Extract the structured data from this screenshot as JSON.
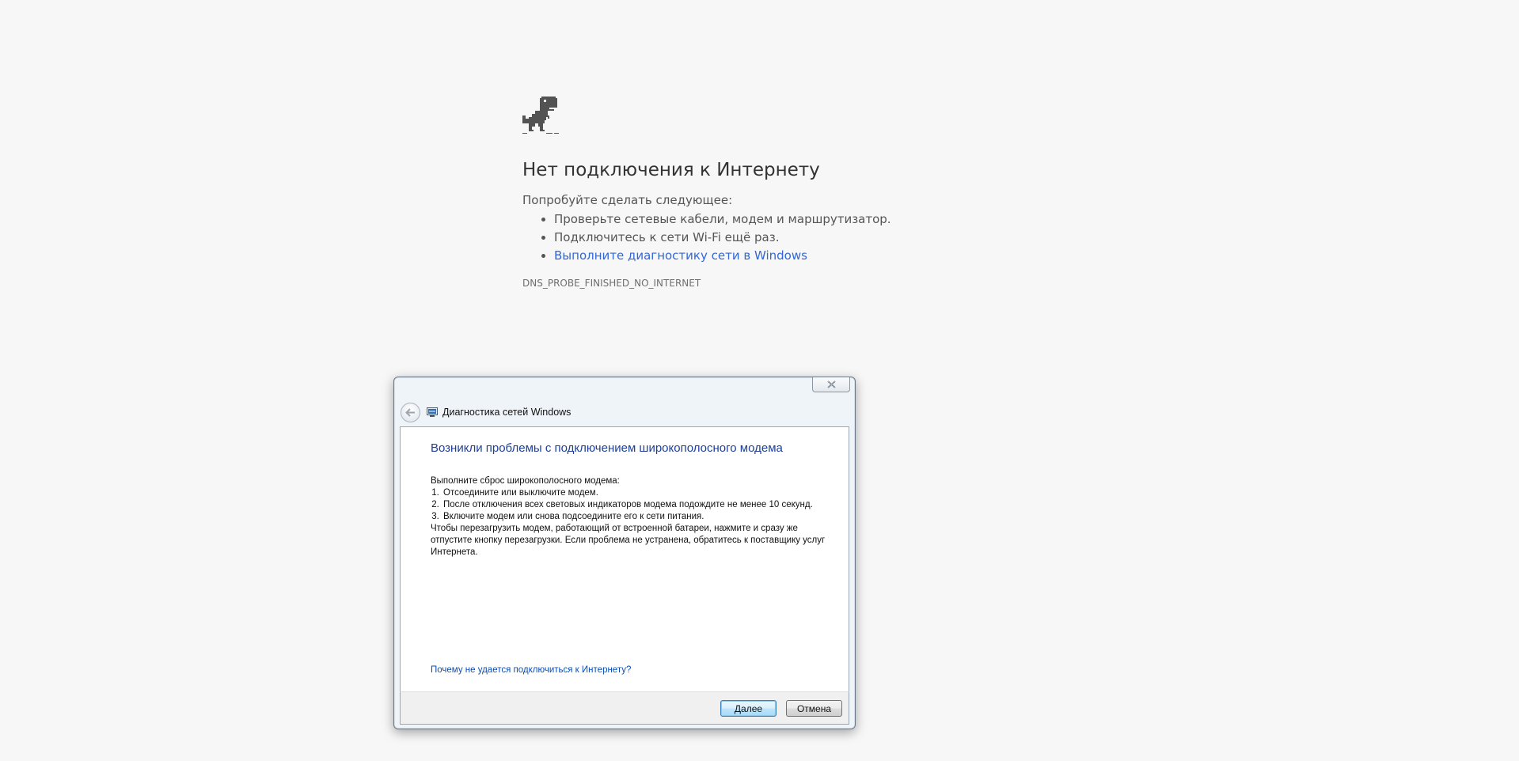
{
  "offline_page": {
    "title": "Нет подключения к Интернету",
    "suggestions_heading": "Попробуйте сделать следующее:",
    "suggestions": [
      "Проверьте сетевые кабели, модем и маршрутизатор.",
      "Подключитесь к сети Wi-Fi ещё раз.",
      "Выполните диагностику сети в Windows"
    ],
    "error_code": "DNS_PROBE_FINISHED_NO_INTERNET",
    "icon": "dino-icon",
    "link_color": "#3367d6"
  },
  "dialog": {
    "title": "Диагностика сетей Windows",
    "heading": "Возникли проблемы с подключением широкополосного модема",
    "intro": "Выполните сброс широкополосного модема:",
    "steps": [
      "Отсоедините или выключите модем.",
      "После отключения всех световых индикаторов модема подождите не менее 10 секунд.",
      "Включите модем или снова подсоедините его к сети питания."
    ],
    "note": "Чтобы перезагрузить модем, работающий от встроенной батареи, нажмите и сразу же отпустите кнопку перезагрузки. Если проблема не устранена, обратитесь к поставщику услуг Интернета.",
    "help_link": "Почему не удается подключиться к Интернету?",
    "next_button": "Далее",
    "cancel_button": "Отмена",
    "heading_color": "#1e3f9a"
  }
}
